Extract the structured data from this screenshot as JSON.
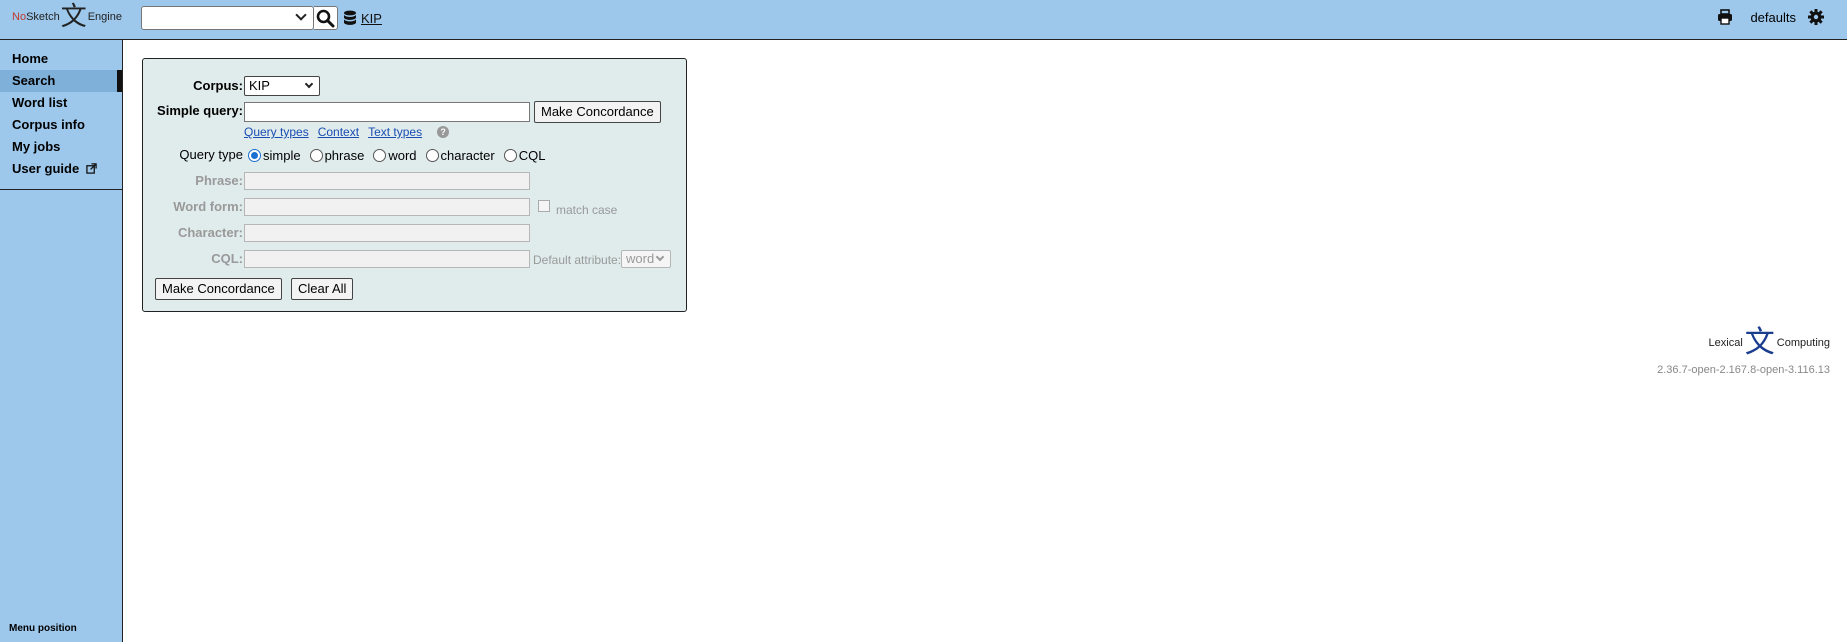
{
  "app": {
    "logo_no": "No",
    "logo_sketch": "Sketch",
    "logo_engine": "Engine",
    "logo_glyph": "文"
  },
  "topbar": {
    "corpus_link": "KIP",
    "defaults_label": "defaults",
    "icons": [
      "search-icon",
      "database-icon",
      "printer-icon",
      "gear-icon"
    ]
  },
  "sidebar": {
    "items": [
      {
        "label": "Home",
        "active": false
      },
      {
        "label": "Search",
        "active": true
      },
      {
        "label": "Word list",
        "active": false
      },
      {
        "label": "Corpus info",
        "active": false
      },
      {
        "label": "My jobs",
        "active": false
      },
      {
        "label": "User guide",
        "active": false
      }
    ],
    "menu_position": "Menu position"
  },
  "form": {
    "corpus_label": "Corpus:",
    "corpus_value": "KIP",
    "simple_query_label": "Simple query:",
    "simple_query_value": "",
    "make_concordance_top": "Make Concordance",
    "links": [
      "Query types",
      "Context",
      "Text types"
    ],
    "query_type_label": "Query type",
    "query_types": [
      "simple",
      "phrase",
      "word",
      "character",
      "CQL"
    ],
    "query_type_selected": "simple",
    "phrase_label": "Phrase:",
    "word_form_label": "Word form:",
    "match_case_label": "match case",
    "character_label": "Character:",
    "cql_label": "CQL:",
    "default_attribute_label": "Default attribute:",
    "default_attribute_value": "word",
    "make_concordance_bottom": "Make Concordance",
    "clear_all": "Clear All"
  },
  "footer": {
    "lc_left": "Lexical",
    "lc_glyph": "文",
    "lc_right": "Computing",
    "version": "2.36.7-open-2.167.8-open-3.116.13"
  },
  "colors": {
    "topbar_bg": "#9dc8ec",
    "panel_bg": "#e0eceb",
    "link": "#1a4db3",
    "active_item": "#7fb0da"
  }
}
